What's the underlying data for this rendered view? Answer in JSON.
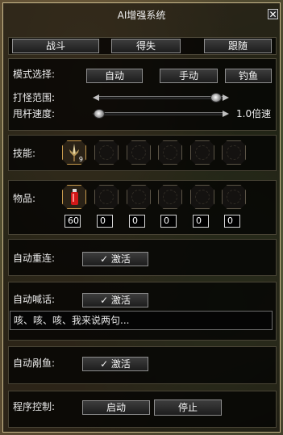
{
  "window": {
    "title": "AI增强系统",
    "close_glyph": "✕"
  },
  "tabs": [
    {
      "label": "战斗"
    },
    {
      "label": "得失"
    },
    {
      "label": "跟随"
    }
  ],
  "mode": {
    "label": "模式选择:",
    "options": [
      "自动",
      "手动",
      "钓鱼"
    ]
  },
  "range": {
    "label": "打怪范围:",
    "value": 0.95
  },
  "cast_speed": {
    "label": "甩杆速度:",
    "value": 0.0,
    "value_text": "1.0倍速"
  },
  "skills": {
    "label": "技能:",
    "slots": [
      {
        "icon": "sword-skill-icon",
        "badge": "9",
        "active": true
      },
      {
        "icon": "empty-slot-icon",
        "badge": "",
        "active": false
      },
      {
        "icon": "empty-slot-icon",
        "badge": "",
        "active": false
      },
      {
        "icon": "empty-slot-icon",
        "badge": "",
        "active": false
      },
      {
        "icon": "empty-slot-icon",
        "badge": "",
        "active": false
      },
      {
        "icon": "empty-slot-icon",
        "badge": "",
        "active": false
      }
    ]
  },
  "items": {
    "label": "物品:",
    "slots": [
      {
        "icon": "red-potion-icon",
        "qty": "60"
      },
      {
        "icon": "empty-slot-icon",
        "qty": "0"
      },
      {
        "icon": "empty-slot-icon",
        "qty": "0"
      },
      {
        "icon": "empty-slot-icon",
        "qty": "0"
      },
      {
        "icon": "empty-slot-icon",
        "qty": "0"
      },
      {
        "icon": "empty-slot-icon",
        "qty": "0"
      }
    ]
  },
  "auto_reconnect": {
    "label": "自动重连:",
    "button": "✓ 激活"
  },
  "auto_shout": {
    "label": "自动喊话:",
    "button": "✓ 激活",
    "message": "咳、咳、咳、我来说两句..."
  },
  "auto_fish_cut": {
    "label": "自动剐鱼:",
    "button": "✓ 激活"
  },
  "program": {
    "label": "程序控制:",
    "start": "启动",
    "stop": "停止"
  },
  "colors": {
    "border": "#c9b98d",
    "panel": "#000000",
    "potion": "#d01818",
    "skill_glow": "#c79a4d"
  }
}
